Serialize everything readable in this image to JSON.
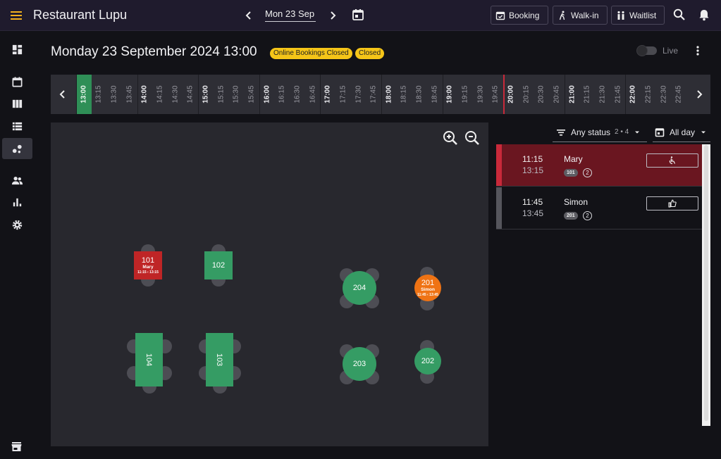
{
  "header": {
    "title": "Restaurant Lupu",
    "date_label": "Mon 23 Sep",
    "buttons": {
      "booking": "Booking",
      "walkin": "Walk-in",
      "waitlist": "Waitlist"
    }
  },
  "icons": {
    "menu": "menu-icon",
    "prev": "chevron-left-icon",
    "next": "chevron-right-icon",
    "calendar": "calendar-icon",
    "search": "search-icon",
    "notifications": "bell-icon"
  },
  "sidebar": {
    "items": [
      {
        "name": "dashboard-icon"
      },
      {
        "name": "calendar-icon"
      },
      {
        "name": "columns-icon"
      },
      {
        "name": "list-icon"
      },
      {
        "name": "floorplan-icon",
        "active": true
      },
      {
        "name": "guests-icon"
      },
      {
        "name": "reports-icon"
      },
      {
        "name": "settings-icon"
      }
    ],
    "bottom": "store-icon"
  },
  "page": {
    "title": "Monday 23 September 2024 13:00",
    "badges": [
      "Online Bookings Closed",
      "Closed"
    ],
    "live_label": "Live",
    "live_on": false
  },
  "timeline": {
    "selected": "13:00",
    "slots": [
      "13:00",
      "13:15",
      "13:30",
      "13:45",
      "14:00",
      "14:15",
      "14:30",
      "14:45",
      "15:00",
      "15:15",
      "15:30",
      "15:45",
      "16:00",
      "16:15",
      "16:30",
      "16:45",
      "17:00",
      "17:15",
      "17:30",
      "17:45",
      "18:00",
      "18:15",
      "18:30",
      "18:45",
      "19:00",
      "19:15",
      "19:30",
      "19:45",
      "20:00",
      "20:15",
      "20:30",
      "20:45",
      "21:00",
      "21:15",
      "21:30",
      "21:45",
      "22:00",
      "22:15",
      "22:30",
      "22:45"
    ]
  },
  "floor": {
    "tables": [
      {
        "id": "101",
        "guest": "Mary",
        "time": "11:15 ‹ 13:15",
        "status": "seated",
        "color": "#bf2526"
      },
      {
        "id": "102",
        "status": "free",
        "color": "#359c64"
      },
      {
        "id": "104",
        "status": "free",
        "color": "#359c64"
      },
      {
        "id": "103",
        "status": "free",
        "color": "#359c64"
      },
      {
        "id": "204",
        "status": "free",
        "color": "#359c64"
      },
      {
        "id": "201",
        "guest": "Simon",
        "time": "11:45 ‹ 13:45",
        "status": "booked",
        "color": "#ef7314"
      },
      {
        "id": "203",
        "status": "free",
        "color": "#359c64"
      },
      {
        "id": "202",
        "status": "free",
        "color": "#359c64"
      }
    ]
  },
  "filters": {
    "status_label": "Any status",
    "status_count": "2 • 4",
    "range_label": "All day"
  },
  "bookings": [
    {
      "start": "11:15",
      "end": "13:15",
      "name": "Mary",
      "table": "101",
      "party": "2",
      "accent": "#c8293a",
      "action": "seat-icon"
    },
    {
      "start": "11:45",
      "end": "13:45",
      "name": "Simon",
      "table": "201",
      "party": "2",
      "accent": "#55555c",
      "action": "thumbs-up-icon"
    }
  ],
  "colors": {
    "accent": "#2f8f57",
    "badge": "#f5c518",
    "seated": "#bf2526",
    "booked": "#ef7314",
    "free": "#359c64",
    "header": "#1f1b2d"
  }
}
